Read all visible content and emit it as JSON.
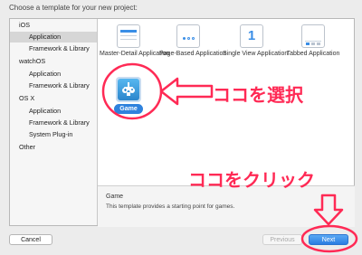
{
  "window": {
    "title": "Choose a template for your new project:"
  },
  "sidebar": {
    "items": [
      {
        "label": "iOS",
        "kind": "category"
      },
      {
        "label": "Application",
        "kind": "sub",
        "selected": true
      },
      {
        "label": "Framework & Library",
        "kind": "sub"
      },
      {
        "label": "watchOS",
        "kind": "category"
      },
      {
        "label": "Application",
        "kind": "sub"
      },
      {
        "label": "Framework & Library",
        "kind": "sub"
      },
      {
        "label": "OS X",
        "kind": "category"
      },
      {
        "label": "Application",
        "kind": "sub"
      },
      {
        "label": "Framework & Library",
        "kind": "sub"
      },
      {
        "label": "System Plug-in",
        "kind": "sub"
      },
      {
        "label": "Other",
        "kind": "category"
      }
    ]
  },
  "templates": [
    {
      "label": "Master-Detail Application",
      "icon": "master-detail-icon"
    },
    {
      "label": "Page-Based Application",
      "icon": "page-based-icon"
    },
    {
      "label": "Single View Application",
      "icon": "single-view-icon",
      "glyph": "1"
    },
    {
      "label": "Tabbed Application",
      "icon": "tabbed-icon"
    },
    {
      "label": "Game",
      "icon": "game-controller-icon",
      "selected": true
    }
  ],
  "description": {
    "title": "Game",
    "text": "This template provides a starting point for games."
  },
  "buttons": {
    "cancel": "Cancel",
    "previous": "Previous",
    "next": "Next"
  },
  "annotations": {
    "select_here": "ココを選択",
    "click_here": "ココをクリック"
  },
  "colors": {
    "annotation": "#ff2a55",
    "accent": "#2f82dd"
  }
}
